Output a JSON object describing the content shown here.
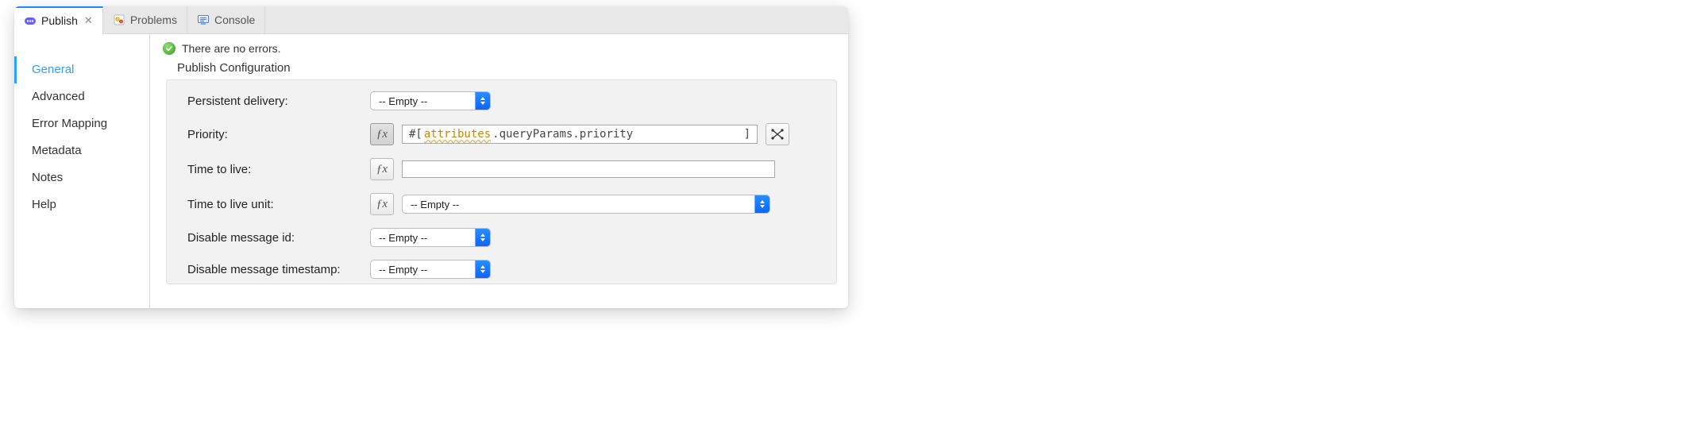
{
  "tabs": {
    "publish": {
      "label": "Publish"
    },
    "problems": {
      "label": "Problems"
    },
    "console": {
      "label": "Console"
    }
  },
  "sidebar": {
    "items": [
      {
        "label": "General"
      },
      {
        "label": "Advanced"
      },
      {
        "label": "Error Mapping"
      },
      {
        "label": "Metadata"
      },
      {
        "label": "Notes"
      },
      {
        "label": "Help"
      }
    ]
  },
  "status": {
    "text": "There are no errors."
  },
  "section": {
    "title": "Publish Configuration"
  },
  "form": {
    "persistent_delivery": {
      "label": "Persistent delivery:",
      "value": "-- Empty --"
    },
    "priority": {
      "label": "Priority:",
      "fx": "ƒx",
      "open": "#[ ",
      "token": "attributes",
      "rest": ".queryParams.priority",
      "close": "]"
    },
    "ttl": {
      "label": "Time to live:",
      "fx": "ƒx",
      "value": ""
    },
    "ttl_unit": {
      "label": "Time to live unit:",
      "fx": "ƒx",
      "value": "-- Empty --"
    },
    "disable_msg_id": {
      "label": "Disable message id:",
      "value": "-- Empty --"
    },
    "disable_msg_ts": {
      "label": "Disable message timestamp:",
      "value": "-- Empty --"
    }
  }
}
